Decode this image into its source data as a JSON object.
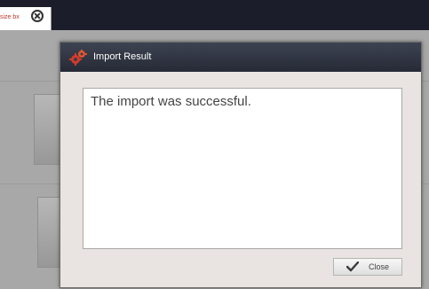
{
  "tab": {
    "label": "size bx",
    "close_icon": "close-circle-icon"
  },
  "dialog": {
    "title": "Import Result",
    "title_icon": "gears-icon",
    "message": "The import was successful.",
    "close_label": "Close",
    "close_icon": "checkmark-icon"
  },
  "colors": {
    "topbar": "#1b1d2b",
    "titlebar": "#2f3341",
    "dialog_bg": "#e9e4e1",
    "tab_text": "#c0392b",
    "gear": "#d83a2a"
  }
}
